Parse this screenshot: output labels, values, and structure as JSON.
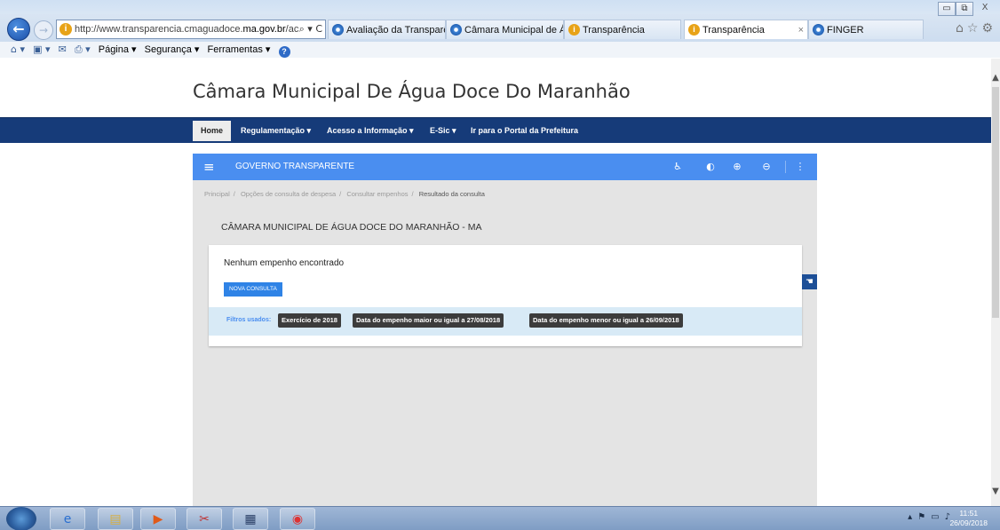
{
  "browser": {
    "address": {
      "prefix": "http://www.transparencia.cmaguadoce.",
      "domain": "ma.gov.br",
      "suffix": "/ac",
      "controls": "⌕ ▾ C"
    },
    "tabs": [
      {
        "label": "Avaliação da Transparê...",
        "icon": "ie-icon"
      },
      {
        "label": "Câmara Municipal de Á...",
        "icon": "ie-icon"
      },
      {
        "label": "Transparência",
        "icon": "warning-icon"
      },
      {
        "label": "Transparência",
        "icon": "warning-icon",
        "active": true
      },
      {
        "label": "FINGER",
        "icon": "ie-icon"
      }
    ],
    "tab_close": "×",
    "command_bar": {
      "pagina": "Página ▾",
      "seguranca": "Segurança ▾",
      "ferramentas": "Ferramentas ▾"
    },
    "window_controls": {
      "minimize": "▭",
      "restore": "⧉",
      "close": "X"
    }
  },
  "site": {
    "title": "Câmara Municipal De Água Doce Do Maranhão",
    "nav": {
      "home": "Home",
      "regulamentacao": "Regulamentação ▾",
      "acesso": "Acesso a Informação ▾",
      "esic": "E-Sic ▾",
      "portal": "Ir para o Portal da Prefeitura"
    }
  },
  "gov_bar": {
    "title": "GOVERNO TRANSPARENTE",
    "icons": [
      "accessibility-icon",
      "contrast-icon",
      "zoom-in-icon",
      "zoom-out-icon",
      "more-icon"
    ]
  },
  "breadcrumb": {
    "items": [
      "Principal",
      "Opções de consulta de despesa",
      "Consultar empenhos"
    ],
    "current": "Resultado da consulta"
  },
  "entity_name": "CÂMARA MUNICIPAL DE ÁGUA DOCE DO MARANHÃO - MA",
  "result": {
    "message": "Nenhum empenho encontrado",
    "button": "NOVA CONSULTA",
    "filters_label": "Filtros usados:",
    "filters": [
      "Exercício de 2018",
      "Data do empenho maior ou igual a 27/08/2018",
      "Data do empenho menor ou igual a 26/09/2018"
    ]
  },
  "taskbar": {
    "time": "11:51",
    "date": "26/09/2018"
  },
  "colors": {
    "nav_bg": "#163b79",
    "gov_bar": "#4a8ef0",
    "button": "#2f83e6",
    "filters_bg": "#d8eaf6",
    "tag_bg": "#3c3c3c"
  }
}
